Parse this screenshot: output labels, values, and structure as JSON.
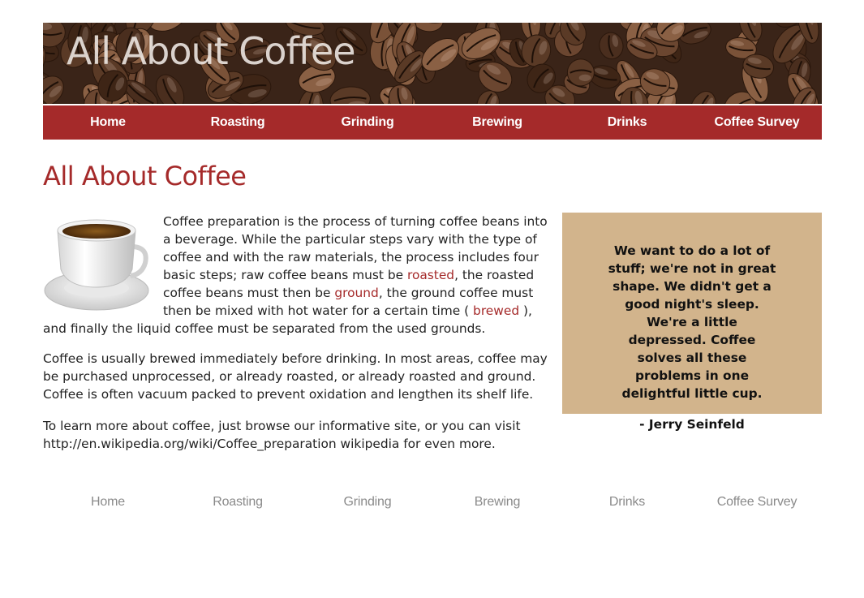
{
  "header": {
    "title": "All About Coffee"
  },
  "nav": {
    "items": [
      {
        "label": "Home"
      },
      {
        "label": "Roasting"
      },
      {
        "label": "Grinding"
      },
      {
        "label": "Brewing"
      },
      {
        "label": "Drinks"
      },
      {
        "label": "Coffee Survey"
      }
    ]
  },
  "main": {
    "heading": "All About Coffee",
    "para1": {
      "part1": "Coffee preparation is the process of turning coffee beans into a beverage. While the particular steps vary with the type of coffee and with the raw materials, the process includes four basic steps; raw coffee beans must be ",
      "link1": "roasted",
      "part2": ", the roasted coffee beans must then be ",
      "link2": "ground",
      "part3": ", the ground coffee must then be mixed with hot water for a certain time ( ",
      "link3": "brewed",
      "part4": " ), and finally the liquid coffee must be separated from the used grounds."
    },
    "para2": "Coffee is usually brewed immediately before drinking. In most areas, coffee may be purchased unprocessed, or already roasted, or already roasted and ground. Coffee is often vacuum packed to prevent oxidation and lengthen its shelf life.",
    "para3": "To learn more about coffee, just browse our informative site, or you can visit http://en.wikipedia.org/wiki/Coffee_preparation wikipedia for even more."
  },
  "quote": {
    "text": "We want to do a lot of stuff; we're not in great shape. We didn't get a good night's sleep. We're a little depressed. Coffee solves all these problems in one delightful little cup.",
    "author": "- Jerry Seinfeld"
  },
  "colors": {
    "accent": "#a52a2a",
    "quote_bg": "#d2b48c",
    "footer_link": "#8a8a8a"
  },
  "icons": {
    "cup": "coffee-cup-image",
    "banner": "coffee-beans-image"
  }
}
